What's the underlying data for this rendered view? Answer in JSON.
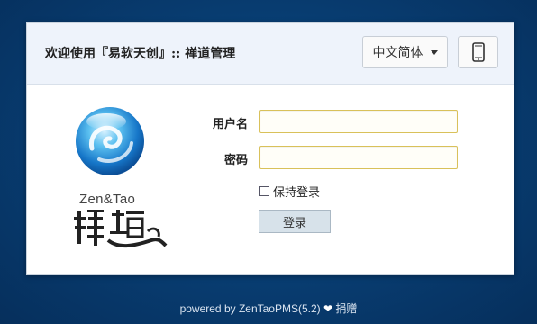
{
  "header": {
    "title": "欢迎使用『易软天创』:: 禅道管理",
    "language_selected": "中文简体",
    "mobile_icon": "mobile-phone-icon"
  },
  "logo": {
    "text": "Zen&Tao",
    "image_icon": "zentao-logo-icon"
  },
  "form": {
    "username_label": "用户名",
    "username_value": "",
    "password_label": "密码",
    "password_value": "",
    "remember_label": "保持登录",
    "remember_checked": false,
    "login_button": "登录"
  },
  "footer": {
    "powered_by": "powered by ZenTaoPMS(5.2)",
    "heart_icon": "heart-icon",
    "donate": "捐赠"
  },
  "colors": {
    "background": "#083c70",
    "panel_header": "#eef3fb",
    "input_border": "#d9c15a",
    "button_bg": "#d7e2ea"
  }
}
